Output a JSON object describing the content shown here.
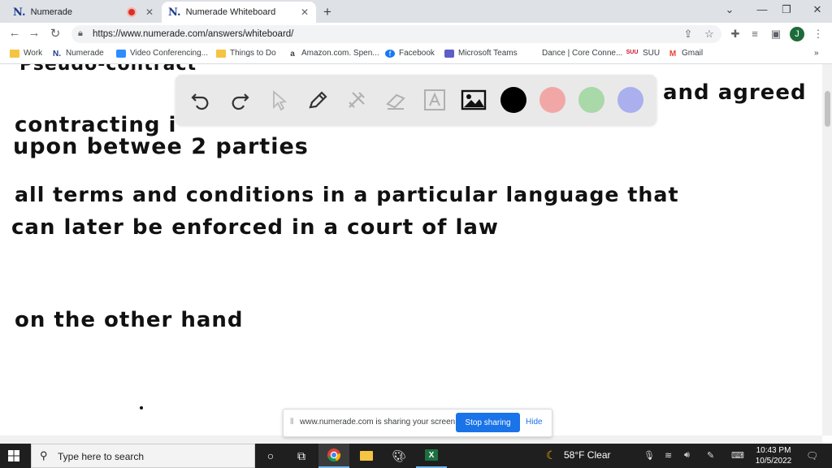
{
  "browser": {
    "tabs": [
      {
        "label": "Numerade",
        "favicon": "N."
      },
      {
        "label": "Numerade Whiteboard",
        "favicon": "N."
      }
    ],
    "new_tab": "+",
    "close": "✕",
    "url": "https://www.numerade.com/answers/whiteboard/",
    "avatar_letter": "J",
    "window": {
      "minimize": "⌄",
      "restore": "—",
      "maximize": "❐",
      "close": "✕"
    }
  },
  "bookmarks": [
    {
      "label": "Work",
      "icon": "folder-icon"
    },
    {
      "label": "Numerade",
      "icon": "numerade-icon"
    },
    {
      "label": "Video Conferencing...",
      "icon": "video-icon"
    },
    {
      "label": "Things to Do",
      "icon": "folder-icon"
    },
    {
      "label": "Amazon.com. Spen...",
      "icon": "amazon-icon"
    },
    {
      "label": "Facebook",
      "icon": "facebook-icon"
    },
    {
      "label": "Microsoft Teams",
      "icon": "teams-icon"
    },
    {
      "label": "Dance | Core Conne...",
      "icon": "page-icon"
    },
    {
      "label": "SUU",
      "icon": "suu-icon"
    },
    {
      "label": "Gmail",
      "icon": "gmail-icon"
    }
  ],
  "bookmarks_more": "»",
  "whiteboard": {
    "lines": [
      "Pseudo-contract",
      "contracting i",
      "and agreed",
      "upon betwee 2 parties",
      "all terms and conditions in a particular language that",
      "can later be enforced in a court of law",
      "on the other hand"
    ],
    "palette_colors": [
      "#000000",
      "#f2a7a7",
      "#a9d8a9",
      "#aab0ee"
    ]
  },
  "share_bar": {
    "message": "www.numerade.com is sharing your screen.",
    "stop_label": "Stop sharing",
    "hide_label": "Hide"
  },
  "taskbar": {
    "search_placeholder": "Type here to search",
    "weather": "58°F  Clear",
    "time": "10:43 PM",
    "date": "10/5/2022"
  }
}
